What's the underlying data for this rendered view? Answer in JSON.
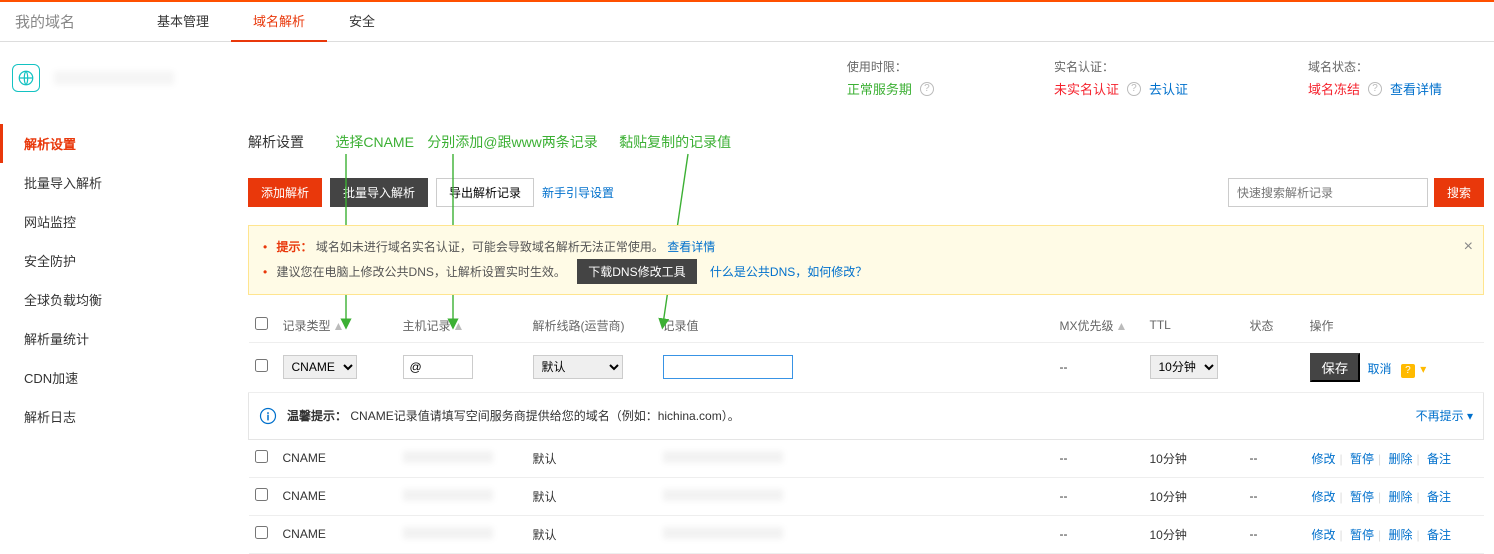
{
  "brand": "我的域名",
  "top_tabs": [
    "基本管理",
    "域名解析",
    "安全"
  ],
  "summary": {
    "usage_label": "使用时限：",
    "usage_value": "正常服务期",
    "realname_label": "实名认证：",
    "realname_value": "未实名认证",
    "realname_action": "去认证",
    "status_label": "域名状态：",
    "status_value": "域名冻结",
    "status_action": "查看详情"
  },
  "sidebar": {
    "items": [
      "解析设置",
      "批量导入解析",
      "网站监控",
      "安全防护",
      "全球负载均衡",
      "解析量统计",
      "CDN加速",
      "解析日志"
    ]
  },
  "page_title": "解析设置",
  "annotations": {
    "sel_cname": "选择CNAME",
    "add_at_www": "分别添加@跟www两条记录",
    "paste": "黏贴复制的记录值"
  },
  "action_bar": {
    "add": "添加解析",
    "import": "批量导入解析",
    "export": "导出解析记录",
    "guide": "新手引导设置"
  },
  "search": {
    "placeholder": "快速搜索解析记录",
    "btn": "搜索"
  },
  "notice": {
    "line1_prefix": "提示：",
    "line1_body": "域名如未进行域名实名认证，可能会导致域名解析无法正常使用。",
    "line1_link": "查看详情",
    "line2_body": "建议您在电脑上修改公共DNS，让解析设置实时生效。",
    "line2_btn": "下载DNS修改工具",
    "line2_link": "什么是公共DNS，如何修改？"
  },
  "columns": {
    "chk": "",
    "type": "记录类型",
    "host": "主机记录",
    "line": "解析线路(运营商)",
    "value": "记录值",
    "mx": "MX优先级",
    "ttl": "TTL",
    "status": "状态",
    "ops": "操作"
  },
  "edit_row": {
    "type_option": "CNAME",
    "host_value": "@",
    "line_option": "默认",
    "mx": "--",
    "ttl_option": "10分钟",
    "save": "保存",
    "cancel": "取消"
  },
  "tip_row": {
    "label": "温馨提示：",
    "body": "CNAME记录值请填写空间服务商提供给您的域名（例如：hichina.com）。",
    "nohint": "不再提示"
  },
  "rows": [
    {
      "type": "CNAME",
      "line": "默认",
      "mx": "--",
      "ttl": "10分钟",
      "status": "--"
    },
    {
      "type": "CNAME",
      "line": "默认",
      "mx": "--",
      "ttl": "10分钟",
      "status": "--"
    },
    {
      "type": "CNAME",
      "line": "默认",
      "mx": "--",
      "ttl": "10分钟",
      "status": "--"
    }
  ],
  "row_ops": {
    "edit": "修改",
    "pause": "暂停",
    "delete": "删除",
    "remark": "备注"
  }
}
